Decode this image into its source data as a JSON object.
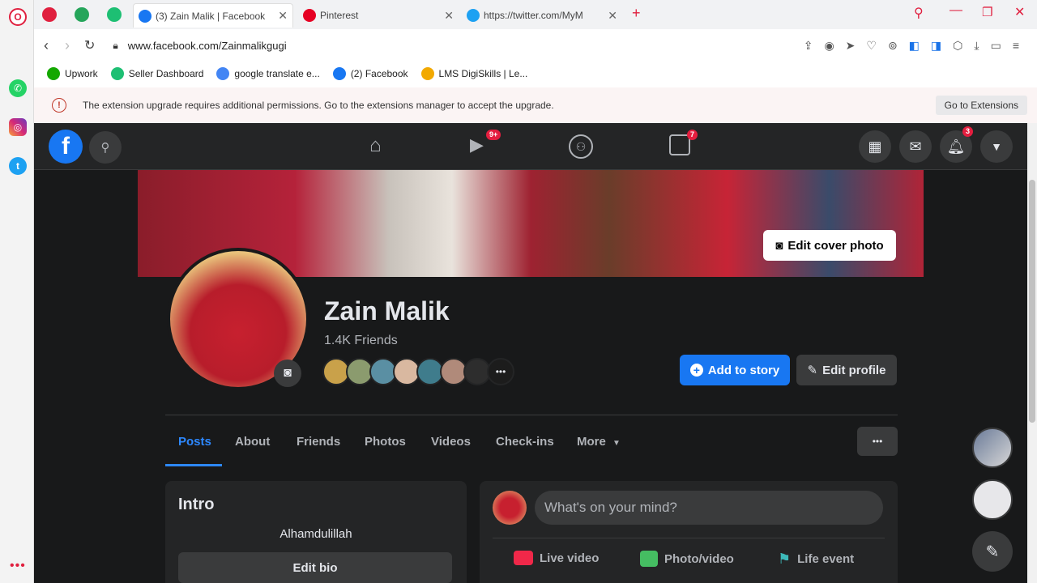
{
  "browser": {
    "tabs": [
      {
        "label": "(3) Zain Malik | Facebook"
      },
      {
        "label": "Pinterest"
      },
      {
        "label": "https://twitter.com/MyM"
      }
    ],
    "url": "www.facebook.com/Zainmalikgugi",
    "bookmarks": [
      {
        "label": "Upwork",
        "color": "#14a800"
      },
      {
        "label": "Seller Dashboard",
        "color": "#1dbf73"
      },
      {
        "label": "google translate e...",
        "color": "#4285f4"
      },
      {
        "label": "(2) Facebook",
        "color": "#1877f2"
      },
      {
        "label": "LMS DigiSkills | Le...",
        "color": "#f2a900"
      }
    ],
    "notice": {
      "text": "The extension upgrade requires additional permissions. Go to the extensions manager to accept the upgrade.",
      "button": "Go to Extensions"
    }
  },
  "facebook": {
    "nav_badges": {
      "watch": "9+",
      "gaming": "7",
      "notifications": "3"
    },
    "cover_button": "Edit cover photo",
    "profile": {
      "name": "Zain Malik",
      "friends": "1.4K Friends",
      "add_story": "Add to story",
      "edit_profile": "Edit profile"
    },
    "tabs": [
      "Posts",
      "About",
      "Friends",
      "Photos",
      "Videos",
      "Check-ins",
      "More"
    ],
    "intro": {
      "title": "Intro",
      "bio": "Alhamdulillah",
      "edit_bio": "Edit bio"
    },
    "composer": {
      "placeholder": "What's on your mind?",
      "actions": [
        "Live video",
        "Photo/video",
        "Life event"
      ]
    }
  },
  "colors": {
    "fb_blue": "#1877f2",
    "dark_bg": "#18191a",
    "card_bg": "#242526",
    "badge_red": "#e41e3f"
  }
}
